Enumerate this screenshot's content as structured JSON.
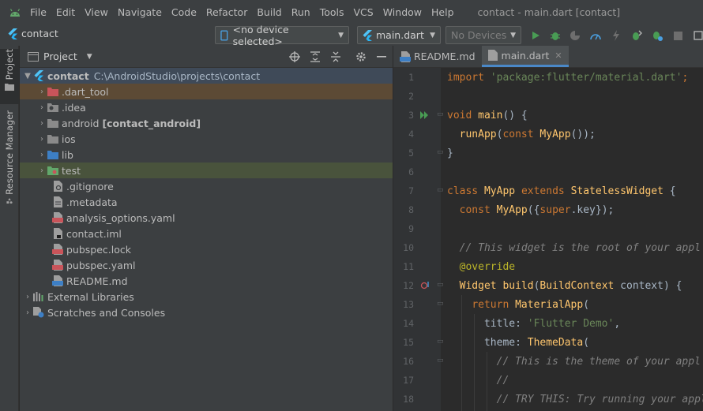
{
  "menu": [
    "File",
    "Edit",
    "View",
    "Navigate",
    "Code",
    "Refactor",
    "Build",
    "Run",
    "Tools",
    "VCS",
    "Window",
    "Help"
  ],
  "window_title": "contact - main.dart [contact]",
  "toolbar": {
    "project_name": "contact",
    "device_selector": "<no device selected>",
    "run_config": "main.dart",
    "devices_combo": "No Devices"
  },
  "left_strip": {
    "project_tab": "Project",
    "resource_tab": "Resource Manager"
  },
  "project_panel": {
    "title": "Project",
    "tree": [
      {
        "name": "contact",
        "path": "C:\\AndroidStudio\\projects\\contact",
        "level": 0,
        "expanded": true,
        "icon": "folder-module-icon"
      },
      {
        "name": ".dart_tool",
        "level": 1,
        "icon": "folder-excluded-icon"
      },
      {
        "name": ".idea",
        "level": 1,
        "icon": "folder-settings-icon"
      },
      {
        "name": "android",
        "suffix": "[contact_android]",
        "level": 1,
        "icon": "folder-android-icon"
      },
      {
        "name": "ios",
        "level": 1,
        "icon": "folder-icon"
      },
      {
        "name": "lib",
        "level": 1,
        "icon": "folder-source-icon"
      },
      {
        "name": "test",
        "level": 1,
        "icon": "folder-test-icon"
      },
      {
        "name": ".gitignore",
        "level": 1,
        "icon": "gitignore-file-icon"
      },
      {
        "name": ".metadata",
        "level": 1,
        "icon": "text-file-icon"
      },
      {
        "name": "analysis_options.yaml",
        "level": 1,
        "icon": "yaml-file-icon"
      },
      {
        "name": "contact.iml",
        "level": 1,
        "icon": "iml-file-icon"
      },
      {
        "name": "pubspec.lock",
        "level": 1,
        "icon": "yaml-file-icon"
      },
      {
        "name": "pubspec.yaml",
        "level": 1,
        "icon": "yaml-file-icon"
      },
      {
        "name": "README.md",
        "level": 1,
        "icon": "markdown-file-icon"
      },
      {
        "name": "External Libraries",
        "level": 0,
        "icon": "libraries-icon"
      },
      {
        "name": "Scratches and Consoles",
        "level": 0,
        "icon": "scratches-icon"
      }
    ]
  },
  "editor": {
    "tabs": [
      {
        "label": "README.md",
        "active": false
      },
      {
        "label": "main.dart",
        "active": true
      }
    ],
    "lines": [
      {
        "n": "1",
        "text": "import 'package:flutter/material.dart';"
      },
      {
        "n": "2",
        "text": ""
      },
      {
        "n": "3",
        "text": "void main() {"
      },
      {
        "n": "4",
        "text": "  runApp(const MyApp());"
      },
      {
        "n": "5",
        "text": "}"
      },
      {
        "n": "6",
        "text": ""
      },
      {
        "n": "7",
        "text": "class MyApp extends StatelessWidget {"
      },
      {
        "n": "8",
        "text": "  const MyApp({super.key});"
      },
      {
        "n": "9",
        "text": ""
      },
      {
        "n": "10",
        "text": "  // This widget is the root of your appl"
      },
      {
        "n": "11",
        "text": "  @override"
      },
      {
        "n": "12",
        "text": "  Widget build(BuildContext context) {"
      },
      {
        "n": "13",
        "text": "    return MaterialApp("
      },
      {
        "n": "14",
        "text": "      title: 'Flutter Demo',"
      },
      {
        "n": "15",
        "text": "      theme: ThemeData("
      },
      {
        "n": "16",
        "text": "        // This is the theme of your appl"
      },
      {
        "n": "17",
        "text": "        //"
      },
      {
        "n": "18",
        "text": "        // TRY THIS: Try running your appl"
      }
    ]
  },
  "colors": {
    "accent": "#4a88c7",
    "run_green": "#499c54",
    "flutter_blue": "#4fc3f7"
  }
}
